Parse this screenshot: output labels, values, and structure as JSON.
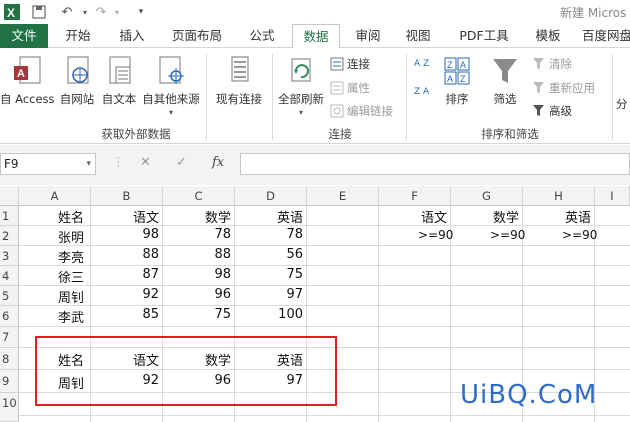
{
  "app": {
    "title": "新建 Micros"
  },
  "tabs": [
    "文件",
    "开始",
    "插入",
    "页面布局",
    "公式",
    "数据",
    "审阅",
    "视图",
    "PDF工具",
    "模板",
    "百度网盘"
  ],
  "ribbon": {
    "external": {
      "access": "自 Access",
      "web": "自网站",
      "text": "自文本",
      "other": "自其他来源",
      "existing": "现有连接",
      "label": "获取外部数据"
    },
    "connections": {
      "refresh_all": "全部刷新",
      "connections": "连接",
      "properties": "属性",
      "edit_links": "编辑链接",
      "label": "连接"
    },
    "sort_filter": {
      "sort": "排序",
      "filter": "筛选",
      "clear": "清除",
      "reapply": "重新应用",
      "advanced": "高级",
      "label": "排序和筛选",
      "az": "A Z",
      "za": "Z A"
    },
    "partial": "分"
  },
  "formula_bar": {
    "name_box": "F9",
    "cancel": "✕",
    "enter": "✓",
    "fx": "fx",
    "value": ""
  },
  "sheet": {
    "columns": [
      "A",
      "B",
      "C",
      "D",
      "E",
      "F",
      "G",
      "H",
      "I"
    ],
    "rows": [
      "1",
      "2",
      "3",
      "4",
      "5",
      "6",
      "7",
      "8",
      "9",
      "10"
    ],
    "data_header": [
      "姓名",
      "语文",
      "数学",
      "英语"
    ],
    "data_rows": [
      [
        "张明",
        "98",
        "78",
        "78"
      ],
      [
        "李亮",
        "88",
        "88",
        "56"
      ],
      [
        "徐三",
        "87",
        "98",
        "75"
      ],
      [
        "周钊",
        "92",
        "96",
        "97"
      ],
      [
        "李武",
        "85",
        "75",
        "100"
      ]
    ],
    "criteria_header": [
      "语文",
      "数学",
      "英语"
    ],
    "criteria_values": [
      ">=90",
      ">=90",
      ">=90"
    ],
    "result_header": [
      "姓名",
      "语文",
      "数学",
      "英语"
    ],
    "result_row": [
      "周钊",
      "92",
      "96",
      "97"
    ]
  },
  "watermark": "UiBQ.CoM",
  "colors": {
    "accent": "#217346",
    "highlight": "#e02020",
    "watermark": "#2e6cc9"
  }
}
